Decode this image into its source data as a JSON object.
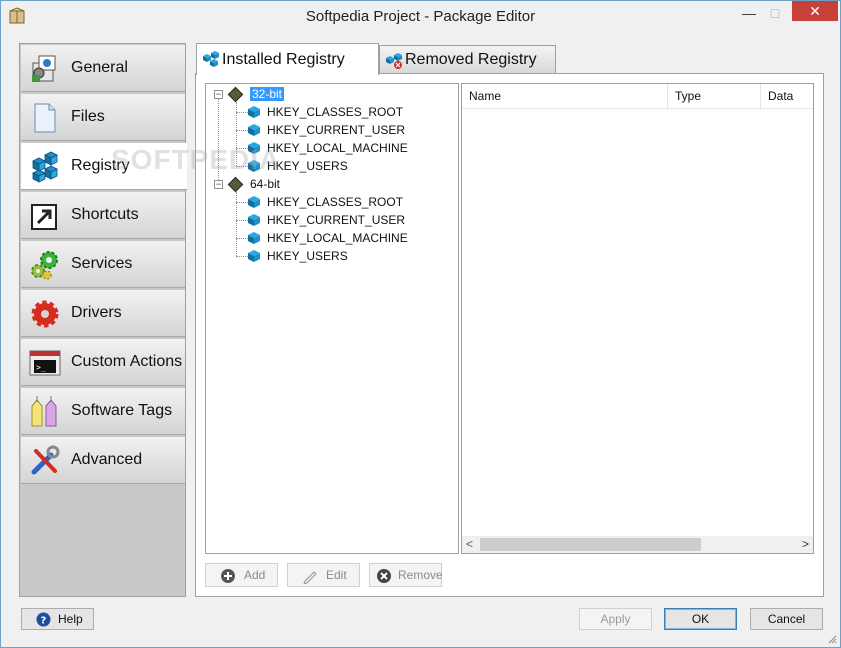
{
  "window": {
    "title": "Softpedia Project - Package Editor",
    "minimize": "—",
    "maximize": "□",
    "close": "✕"
  },
  "sidebar": {
    "items": [
      {
        "label": "General",
        "icon": "package-icon"
      },
      {
        "label": "Files",
        "icon": "file-icon"
      },
      {
        "label": "Registry",
        "icon": "registry-cubes-icon"
      },
      {
        "label": "Shortcuts",
        "icon": "shortcut-arrow-icon"
      },
      {
        "label": "Services",
        "icon": "gears-icon"
      },
      {
        "label": "Drivers",
        "icon": "red-gear-icon"
      },
      {
        "label": "Custom Actions",
        "icon": "console-icon"
      },
      {
        "label": "Software Tags",
        "icon": "tags-icon"
      },
      {
        "label": "Advanced",
        "icon": "tools-icon"
      }
    ],
    "active": "Registry"
  },
  "tabs": {
    "installed": "Installed Registry",
    "removed": "Removed Registry"
  },
  "tree": {
    "group32": "32-bit",
    "group64": "64-bit",
    "keys32": [
      "HKEY_CLASSES_ROOT",
      "HKEY_CURRENT_USER",
      "HKEY_LOCAL_MACHINE",
      "HKEY_USERS"
    ],
    "keys64": [
      "HKEY_CLASSES_ROOT",
      "HKEY_CURRENT_USER",
      "HKEY_LOCAL_MACHINE",
      "HKEY_USERS"
    ]
  },
  "list": {
    "columns": [
      "Name",
      "Type",
      "Data"
    ]
  },
  "actions": {
    "add": "Add",
    "edit": "Edit",
    "remove": "Remove"
  },
  "footer": {
    "help": "Help",
    "apply": "Apply",
    "ok": "OK",
    "cancel": "Cancel"
  },
  "watermark": "SOFTPEDIA",
  "colors": {
    "selection": "#3399ff",
    "close_button": "#c7403a",
    "registry_cube": "#1e90c8"
  }
}
